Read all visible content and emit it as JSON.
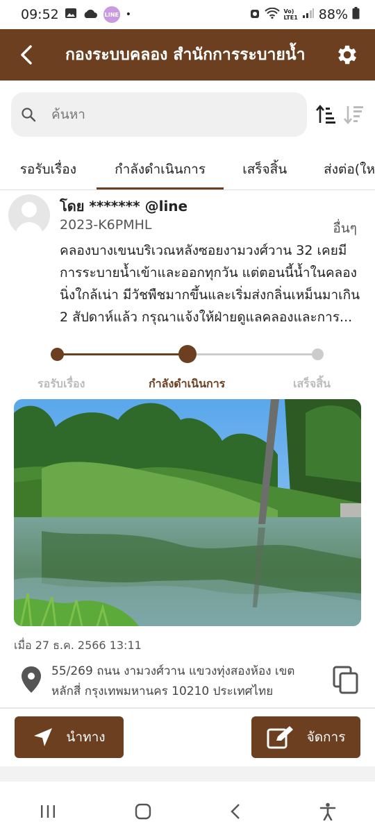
{
  "status_bar": {
    "time": "09:52",
    "line_badge": "LINE",
    "dot": "•",
    "lte_label": "Vo)\nLTE1",
    "battery": "88%"
  },
  "app_bar": {
    "title": "กองระบบคลอง สำนักการระบายน้ำ"
  },
  "search": {
    "placeholder": "ค้นหา"
  },
  "tabs": [
    {
      "label": "รอรับเรื่อง",
      "active": false
    },
    {
      "label": "กำลังดำเนินการ",
      "active": true
    },
    {
      "label": "เสร็จสิ้น",
      "active": false
    },
    {
      "label": "ส่งต่อ(ให",
      "active": false
    }
  ],
  "report": {
    "byline": "โดย ******* @line",
    "ticket_id": "2023-K6PMHL",
    "category": "อื่นๆ",
    "description_lines": [
      "คลองบางเขนบริเวณหลังซอยงามวงศ์วาน 32 เคยมี",
      "การระบายน้ำเข้าและออกทุกวัน แต่ตอนนี้น้ำในคลอง",
      "นิ่งใกล้เน่า มีวัชพืชมากขึ้นและเริ่มส่งกลิ่นเหม็นมาเกิน",
      "2 สัปดาห์แล้ว กรุณาแจ้งให้ฝ่ายดูแลคลองและการ..."
    ],
    "progress": {
      "steps": [
        "รอรับเรื่อง",
        "กำลังดำเนินการ",
        "เสร็จสิ้น"
      ],
      "current_step": 2
    },
    "timestamp": "เมื่อ 27 ธ.ค. 2566 13:11",
    "address_lines": [
      "55/269 ถนน งามวงศ์วาน แขวงทุ่งสองห้อง เขต",
      "หลักสี่ กรุงเทพมหานคร 10210 ประเทศไทย"
    ],
    "navigate_label": "นำทาง",
    "manage_label": "จัดการ"
  },
  "colors": {
    "brand": "#6b3f1f",
    "inactive_track": "#cccccc",
    "inactive_label": "#bbbbbb"
  },
  "icons": {
    "back": "back-arrow-icon",
    "settings": "gear-icon",
    "search": "search-icon",
    "sort_asc": "sort-ascending-icon",
    "sort_desc": "sort-descending-icon",
    "location": "location-pin-icon",
    "copy": "copy-icon",
    "navigate": "navigation-arrow-icon",
    "edit": "edit-icon"
  }
}
